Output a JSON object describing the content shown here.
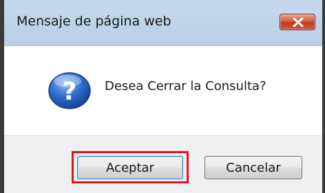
{
  "dialog": {
    "title": "Mensaje de página web",
    "message": "Desea Cerrar la Consulta?",
    "close_icon": "close-icon",
    "message_icon": "question-icon"
  },
  "buttons": {
    "accept_label": "Aceptar",
    "cancel_label": "Cancelar"
  },
  "colors": {
    "highlight": "#e0121e",
    "close_button": "#c8462d",
    "title_bar": "#bfd3eb"
  }
}
